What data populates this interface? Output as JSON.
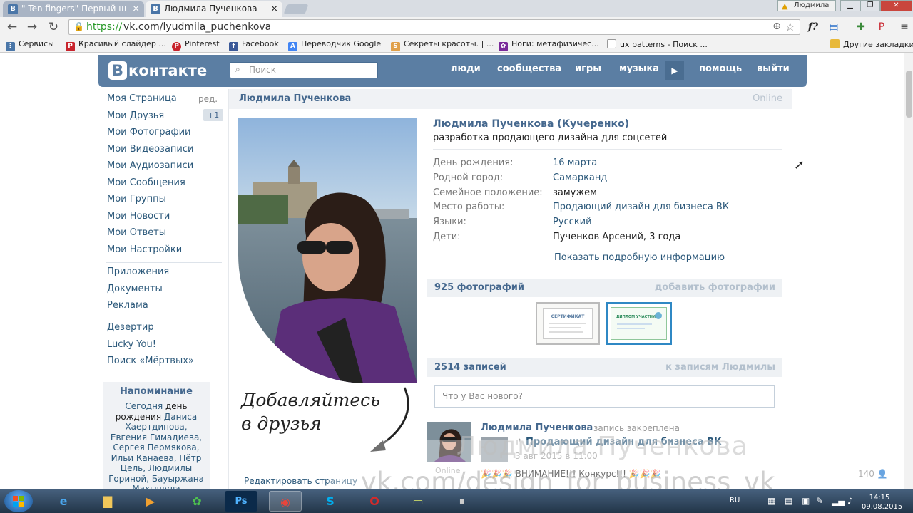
{
  "browser": {
    "tabs": [
      {
        "title": "\" Ten fingers\" Первый ш",
        "active": false
      },
      {
        "title": "Людмила Пученкова",
        "active": true
      }
    ],
    "window_user": "Людмила",
    "url_scheme": "https://",
    "url_host": "vk.com/lyudmila_puchenkova",
    "bookmarks": [
      {
        "label": "Сервисы",
        "icon": "apps-grid-icon"
      },
      {
        "label": "Красивый слайдер ...",
        "icon": "pinterest-p-icon"
      },
      {
        "label": "Pinterest",
        "icon": "pinterest-icon"
      },
      {
        "label": "Facebook",
        "icon": "facebook-icon"
      },
      {
        "label": "Переводчик Google",
        "icon": "translate-icon"
      },
      {
        "label": "Секреты красоты. | ...",
        "icon": "page-icon"
      },
      {
        "label": "Ноги: метафизичес...",
        "icon": "butterfly-icon"
      },
      {
        "label": "ux patterns - Поиск ...",
        "icon": "document-icon"
      }
    ],
    "other_bookmarks": "Другие закладки"
  },
  "vk": {
    "logo": "контакте",
    "logo_letter": "В",
    "search_placeholder": "Поиск",
    "nav": [
      "люди",
      "сообщества",
      "игры",
      "музыка",
      "помощь",
      "выйти"
    ]
  },
  "left_menu": {
    "items": [
      "Моя Страница",
      "Мои Друзья",
      "Мои Фотографии",
      "Мои Видеозаписи",
      "Мои Аудиозаписи",
      "Мои Сообщения",
      "Мои Группы",
      "Мои Новости",
      "Мои Ответы",
      "Мои Настройки"
    ],
    "edit": "ред.",
    "friends_badge": "+1",
    "extra": [
      "Приложения",
      "Документы",
      "Реклама"
    ],
    "apps": [
      "Дезертир",
      "Lucky You!",
      "Поиск «Мёртвых»"
    ]
  },
  "reminder": {
    "title": "Напоминание",
    "today": "Сегодня",
    "day_word": "день рождения",
    "names": "Даниса Хаертдинова, Евгения Гимадиева, Сергея Пермякова, Ильи Канаева, Пётр Цель, Людмилы Гориной, Бауыржана Махышула"
  },
  "profile": {
    "header_name": "Людмила Пученкова",
    "online": "Online",
    "full_name": "Людмила Пученкова (Кучеренко)",
    "status": "разработка продающего дизайна для соцсетей",
    "fields": [
      {
        "label": "День рождения:",
        "value": "16 марта",
        "link": true
      },
      {
        "label": "Родной город:",
        "value": "Самарканд",
        "link": true
      },
      {
        "label": "Семейное положение:",
        "value": "замужем",
        "link": false
      },
      {
        "label": "Место работы:",
        "value": "Продающий дизайн для бизнеса ВК",
        "link": true
      },
      {
        "label": "Языки:",
        "value": "Русский",
        "link": true
      },
      {
        "label": "Дети:",
        "value": "Пученков Арсений, 3 года",
        "link": false
      }
    ],
    "more_info": "Показать подробную информацию",
    "promo_line1": "Добавляйтесь",
    "promo_line2": "в друзья",
    "edit_page": "Редактировать страницу"
  },
  "photos": {
    "count_label": "925 фотографий",
    "add_label": "добавить фотографии",
    "thumb1_text": "СЕРТИФИКАТ",
    "thumb2_text": "ДИПЛОМ УЧАСТНИКА"
  },
  "wall": {
    "count_label": "2514 записей",
    "to_posts": "к записям Людмилы",
    "new_post_placeholder": "Что у Вас нового?",
    "post": {
      "author": "Людмила Пученкова",
      "pinned": "запись закреплена",
      "link_title": "Продающий дизайн для бизнеса ВК",
      "date": "3 авг 2015 в 11:00",
      "online": "Online",
      "text": "ВНИМАНИЕ!!! Конкурс!!!",
      "likes": "140"
    }
  },
  "watermark": {
    "line1": "Людмила Пученкова",
    "line2": "vk.com/design_for_business_vk"
  },
  "taskbar": {
    "lang": "RU",
    "time": "14:15",
    "date": "09.08.2015"
  }
}
